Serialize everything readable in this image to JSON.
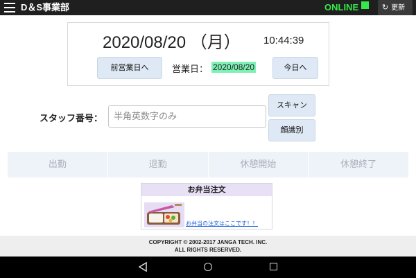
{
  "app": {
    "title": "D＆S事業部",
    "status": "ONLINE",
    "refresh_label": "更新"
  },
  "colors": {
    "topbar": "#1f1f1f",
    "online": "#35e84a",
    "button_bg": "#dfe9f5",
    "bizday_highlight": "#7ef1b5",
    "attendance_row": "#eef3fa"
  },
  "date_panel": {
    "date": "2020/08/20 （月）",
    "time": "10:44:39",
    "prev_button": "前営業日へ",
    "bizday_label": "営業日：",
    "bizday_value": "2020/08/20",
    "today_button": "今日へ"
  },
  "staff": {
    "label": "スタッフ番号：",
    "placeholder": "半角英数字のみ",
    "value": "",
    "scan_button": "スキャン",
    "face_button": "顔識別"
  },
  "attendance": {
    "buttons": [
      "出勤",
      "退勤",
      "休憩開始",
      "休憩終了"
    ]
  },
  "bento": {
    "title": "お弁当注文",
    "link": "お弁当の注文はここです！！"
  },
  "footer": {
    "line1": "COPYRIGHT © 2002-2017 JANGA TECH. INC.",
    "line2": "ALL RIGHTS RESERVED."
  },
  "icons": {
    "menu": "hamburger-menu-icon",
    "refresh": "refresh-icon",
    "nav_back": "back-triangle-icon",
    "nav_home": "home-circle-icon",
    "nav_recent": "recent-square-icon"
  }
}
